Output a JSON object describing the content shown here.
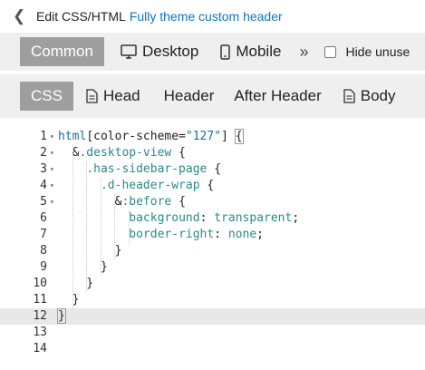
{
  "title_bar": {
    "prefix": "Edit CSS/HTML",
    "theme_name": "Fully theme custom header"
  },
  "target_tabs": {
    "common": "Common",
    "desktop": "Desktop",
    "mobile": "Mobile",
    "more": "»",
    "hide_label": "Hide unuse"
  },
  "field_tabs": {
    "css": "CSS",
    "head": "Head",
    "header": "Header",
    "after_header": "After Header",
    "body": "Body"
  },
  "editor": {
    "active_line": 12,
    "lines": [
      {
        "n": "1",
        "fold": "▾",
        "tokens": [
          {
            "t": "tag",
            "v": "html"
          },
          {
            "t": "punc",
            "v": "[color-scheme="
          },
          {
            "t": "str",
            "v": "\"127\""
          },
          {
            "t": "punc",
            "v": "] "
          },
          {
            "t": "punc",
            "v": "{"
          }
        ]
      },
      {
        "n": "2",
        "fold": "▾",
        "tokens": [
          {
            "t": "punc",
            "v": "  &"
          },
          {
            "t": "cls",
            "v": ".desktop-view"
          },
          {
            "t": "punc",
            "v": " {"
          }
        ]
      },
      {
        "n": "3",
        "fold": "▾",
        "tokens": [
          {
            "t": "punc",
            "v": "    "
          },
          {
            "t": "cls",
            "v": ".has-sidebar-page"
          },
          {
            "t": "punc",
            "v": " {"
          }
        ]
      },
      {
        "n": "4",
        "fold": "▾",
        "tokens": [
          {
            "t": "punc",
            "v": "      "
          },
          {
            "t": "cls",
            "v": ".d-header-wrap"
          },
          {
            "t": "punc",
            "v": " {"
          }
        ]
      },
      {
        "n": "5",
        "fold": "▾",
        "tokens": [
          {
            "t": "punc",
            "v": "        &"
          },
          {
            "t": "cls",
            "v": ":before"
          },
          {
            "t": "punc",
            "v": " {"
          }
        ]
      },
      {
        "n": "6",
        "fold": "",
        "tokens": [
          {
            "t": "punc",
            "v": "          "
          },
          {
            "t": "prop",
            "v": "background"
          },
          {
            "t": "punc",
            "v": ": "
          },
          {
            "t": "val",
            "v": "transparent"
          },
          {
            "t": "punc",
            "v": ";"
          }
        ]
      },
      {
        "n": "7",
        "fold": "",
        "tokens": [
          {
            "t": "punc",
            "v": "          "
          },
          {
            "t": "prop",
            "v": "border-right"
          },
          {
            "t": "punc",
            "v": ": "
          },
          {
            "t": "val",
            "v": "none"
          },
          {
            "t": "punc",
            "v": ";"
          }
        ]
      },
      {
        "n": "8",
        "fold": "",
        "tokens": [
          {
            "t": "punc",
            "v": "        }"
          }
        ]
      },
      {
        "n": "9",
        "fold": "",
        "tokens": [
          {
            "t": "punc",
            "v": "      }"
          }
        ]
      },
      {
        "n": "10",
        "fold": "",
        "tokens": [
          {
            "t": "punc",
            "v": "    }"
          }
        ]
      },
      {
        "n": "11",
        "fold": "",
        "tokens": [
          {
            "t": "punc",
            "v": "  }"
          }
        ]
      },
      {
        "n": "12",
        "fold": "",
        "tokens": [
          {
            "t": "punc",
            "v": "}"
          }
        ]
      },
      {
        "n": "13",
        "fold": "",
        "tokens": []
      },
      {
        "n": "14",
        "fold": "",
        "tokens": []
      }
    ]
  },
  "colors": {
    "link": "#0e76bd",
    "selected_tab_bg": "#9e9e9e",
    "toolbar_bg": "#efefef"
  }
}
